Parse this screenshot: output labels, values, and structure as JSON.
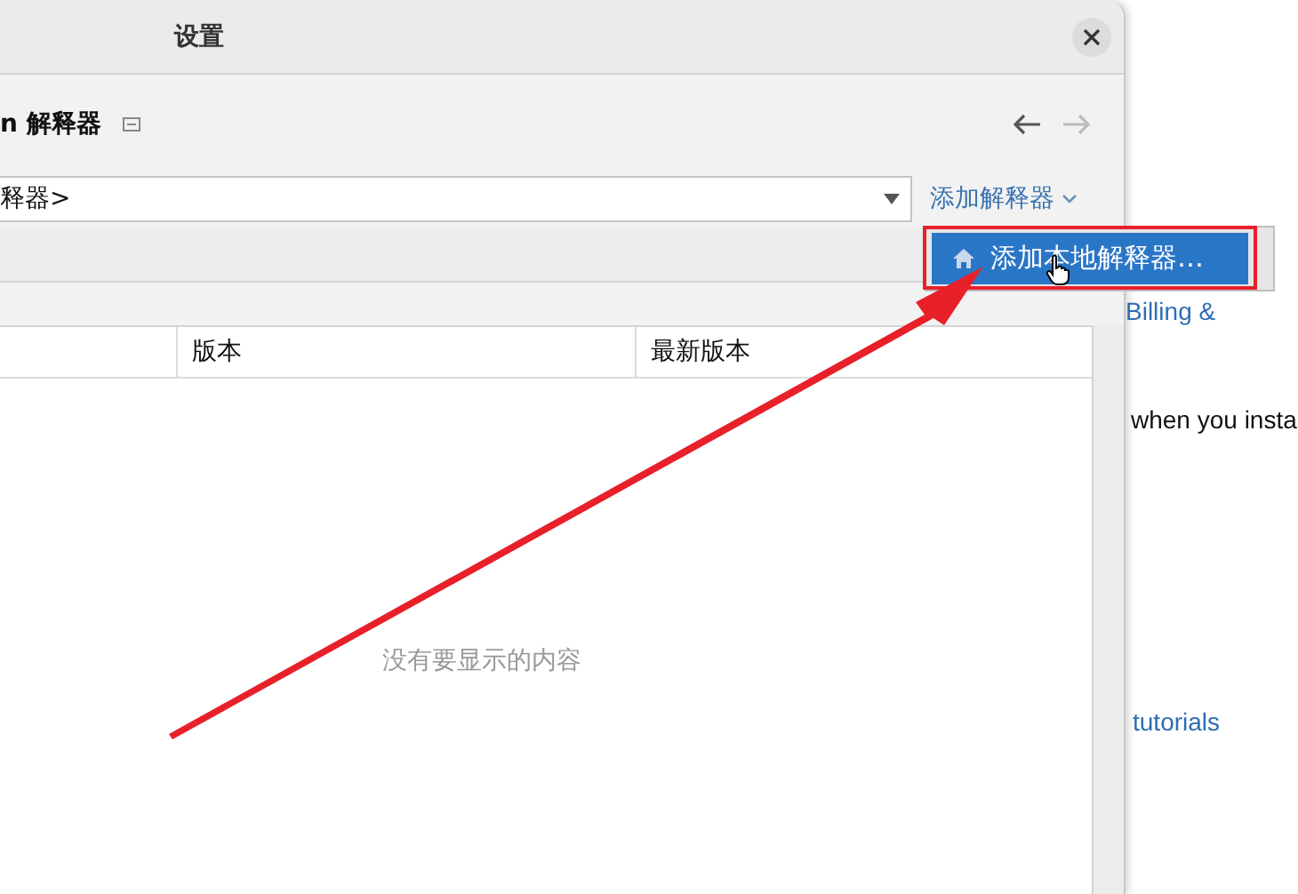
{
  "dialog": {
    "title": "设置",
    "heading": "n 解释器",
    "nav": {
      "back_enabled": true,
      "forward_enabled": false
    },
    "interpreter_combo": {
      "value": "释器>"
    },
    "add_link": "添加解释器",
    "menu": {
      "items": [
        {
          "label": "添加本地解释器…",
          "selected": true
        }
      ]
    },
    "table": {
      "columns": [
        "版本",
        "最新版本"
      ],
      "empty_text": "没有要显示的内容"
    }
  },
  "background_page": {
    "texts": [
      {
        "text": "Billing &",
        "kind": "link"
      },
      {
        "text": "when you insta",
        "kind": "text"
      },
      {
        "text": "tutorials",
        "kind": "link"
      }
    ]
  }
}
